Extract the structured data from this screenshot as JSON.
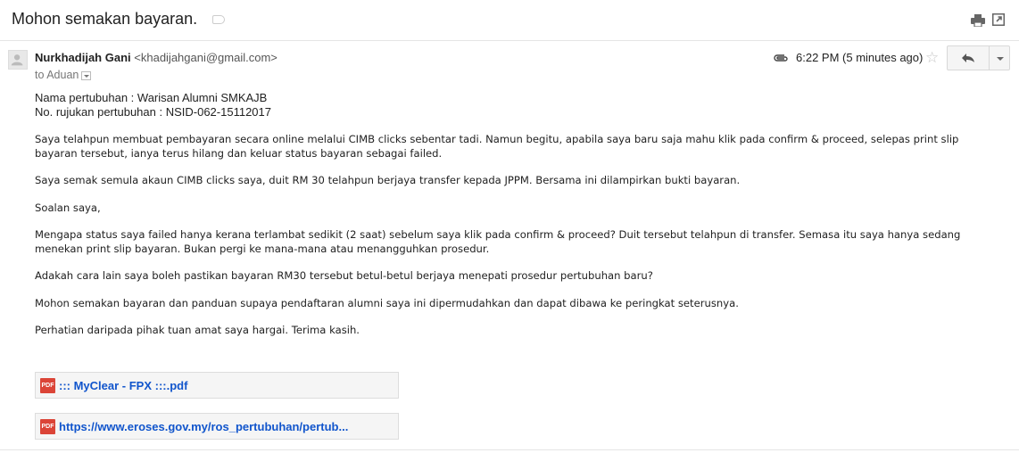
{
  "subject": "Mohon semakan bayaran.",
  "sender": {
    "name": "Nurkhadijah Gani",
    "email": "<khadijahgani@gmail.com>",
    "to": "to Aduan"
  },
  "date": "6:22 PM (5 minutes ago)",
  "body": {
    "org_name": "Nama pertubuhan : Warisan Alumni SMKAJB",
    "org_ref": "No. rujukan pertubuhan : NSID-062-15112017",
    "p1": "Saya telahpun membuat pembayaran secara online melalui CIMB clicks sebentar tadi. Namun begitu, apabila saya baru saja mahu klik pada confirm & proceed, selepas print slip bayaran tersebut, ianya terus hilang dan keluar status bayaran sebagai failed.",
    "p2": "Saya semak semula akaun CIMB clicks saya, duit RM 30 telahpun berjaya transfer kepada JPPM. Bersama ini dilampirkan bukti bayaran.",
    "p3": "Soalan saya,",
    "p4": "Mengapa status saya failed hanya kerana terlambat sedikit (2 saat) sebelum saya klik pada confirm & proceed? Duit tersebut telahpun di transfer. Semasa itu saya hanya sedang menekan print slip bayaran. Bukan pergi ke mana-mana atau menangguhkan prosedur.",
    "p5": "Adakah cara lain saya boleh pastikan bayaran RM30 tersebut betul-betul berjaya menepati prosedur pertubuhan baru?",
    "p6": "Mohon semakan bayaran dan panduan supaya pendaftaran alumni saya ini dipermudahkan dan dapat dibawa ke peringkat seterusnya.",
    "p7": "Perhatian daripada pihak tuan amat saya hargai. Terima kasih."
  },
  "attachments": [
    {
      "name": "::: MyClear - FPX :::.pdf",
      "icon": "PDF"
    },
    {
      "name": "https://www.eroses.gov.my/ros_pertubuhan/pertub...",
      "icon": "PDF"
    }
  ],
  "icons": {
    "print": "print-icon",
    "new_window": "new-window-icon",
    "attachment": "paperclip-icon",
    "star": "star-icon",
    "reply": "reply-icon",
    "more": "chevron-down-icon"
  },
  "colors": {
    "link": "#1155cc",
    "pdf_badge": "#db4437"
  }
}
